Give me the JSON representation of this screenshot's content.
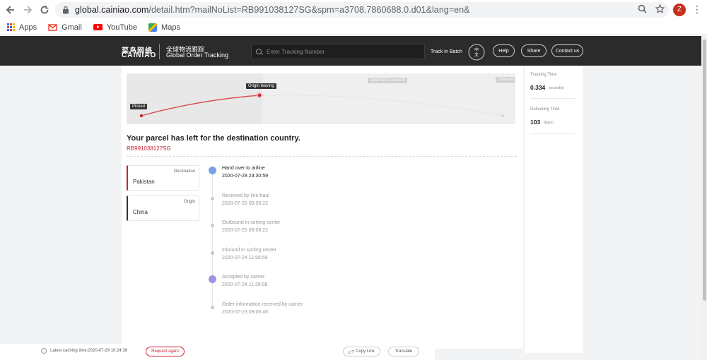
{
  "browser": {
    "url_host": "global.cainiao.com",
    "url_rest": "/detail.htm?mailNoList=RB991038127SG&spm=a3708.7860688.0.d01&lang=en&",
    "profile_initial": "Z",
    "bookmarks": [
      {
        "label": "Apps",
        "icon": "apps-icon"
      },
      {
        "label": "Gmail",
        "icon": "gmail-icon"
      },
      {
        "label": "YouTube",
        "icon": "youtube-icon"
      },
      {
        "label": "Maps",
        "icon": "maps-icon"
      }
    ]
  },
  "header": {
    "logo_cn": "菜鸟网络",
    "logo_en": "CAINIAO",
    "tagline_cn": "全球物流跟踪",
    "tagline_en": "Global Order Tracking",
    "search_placeholder": "Enter Tracking Number",
    "batch_label": "Track In Batch",
    "lang_label": "中文",
    "help_label": "Help",
    "share_label": "Share",
    "contact_label": "Contact us"
  },
  "map": {
    "stages": [
      "Picked",
      "Origin leaving",
      "Destination arrived",
      "Delivered"
    ],
    "active_stage_index": 1
  },
  "parcel": {
    "status_title": "Your parcel has left for the destination country.",
    "tracking_number": "RB991038127SG"
  },
  "route": {
    "destination_label": "Destination",
    "destination_value": "Pakistan",
    "origin_label": "Origin",
    "origin_value": "China"
  },
  "timeline": [
    {
      "event": "Hand over to airline",
      "time": "2020-07-28 23:30:59",
      "current": true
    },
    {
      "event": "Received by line-haul",
      "time": "2020-07-25 09:09:22",
      "current": false
    },
    {
      "event": "Outbound in sorting center",
      "time": "2020-07-25 09:09:22",
      "current": false
    },
    {
      "event": "Inbound in sorting center",
      "time": "2020-07-24 11:56:58",
      "current": false
    },
    {
      "event": "Accepted by carrier",
      "time": "2020-07-24 11:26:58",
      "current": false
    },
    {
      "event": "Order information received by carrier",
      "time": "2020-07-23 09:06:46",
      "current": false
    }
  ],
  "stats": {
    "tracking_time_label": "Tracking Time",
    "tracking_time_value": "0.334",
    "tracking_time_unit": "second(s)",
    "delivering_time_label": "Delivering Time",
    "delivering_time_value": "103",
    "delivering_time_unit": "day(s)"
  },
  "footer": {
    "cache_text": "Latest caching time:2020-07-29 10:24:38",
    "request_again": "Request again",
    "copy_link": "Copy Link",
    "translate": "Translate"
  },
  "colors": {
    "brand_red": "#c8202e",
    "header_bg": "#2b2b2b"
  }
}
